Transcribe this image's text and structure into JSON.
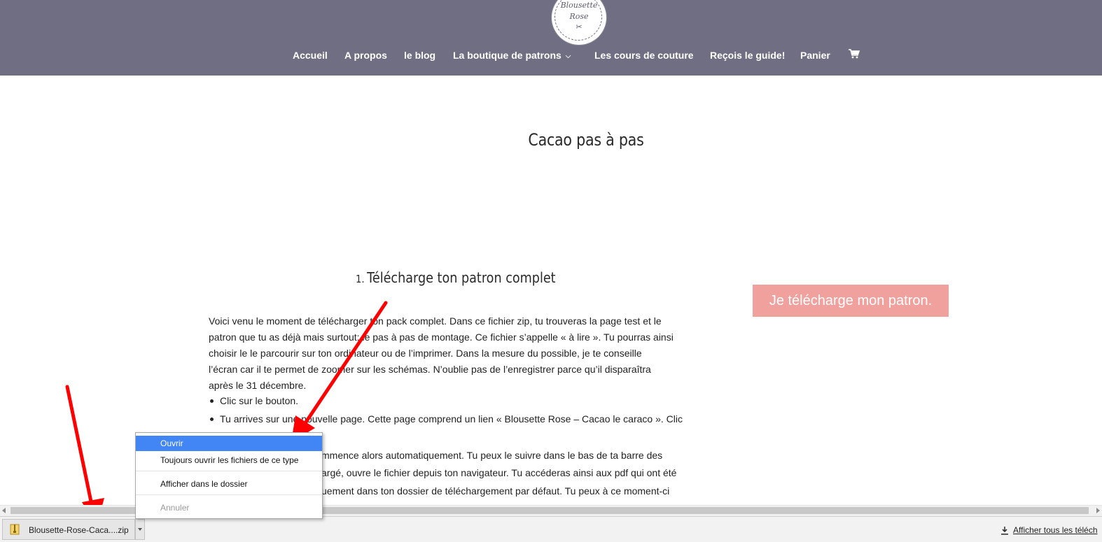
{
  "header": {
    "logo": {
      "line1": "Blousette",
      "line2": "Rose"
    },
    "nav": [
      {
        "label": "Accueil"
      },
      {
        "label": "A propos"
      },
      {
        "label": "le blog"
      },
      {
        "label": "La boutique de patrons",
        "has_dropdown": true
      },
      {
        "label": "Les cours de couture"
      },
      {
        "label": "Reçois le guide!"
      },
      {
        "label": "Panier"
      }
    ],
    "cart_icon": "cart-icon",
    "background": "#6f6e82"
  },
  "main": {
    "title": "Cacao pas à pas",
    "step": {
      "number": "1.",
      "heading": "Télécharge ton patron complet"
    },
    "paragraph_lines": [
      "Voici venu le moment de télécharger ton pack complet. Dans ce fichier zip, tu trouveras la page test et le",
      "patron que tu as déjà mais surtout: le pas à pas de montage. Ce fichier s’appelle « à lire ». Tu pourras ainsi",
      "choisir le le parcourir sur ton ordinateur ou de l’imprimer. Dans la mesure du possible, je te conseille",
      "l’écran car il te permet de zoomer sur les schémas. N’oublie pas de l’enregistrer parce qu’il disparaîtra",
      "après le 31 décembre."
    ],
    "bullets": [
      "Clic sur le bouton.",
      "Tu arrives sur une nouvelle page. Cette page comprend un lien « Blousette Rose – Cacao le caraco ». Clic"
    ],
    "continued_lines": [
      "mmence alors automatiquement. Tu peux le suivre dans le bas de ta barre des",
      "argé, ouvre le fichier depuis ton navigateur. Tu accéderas ainsi aux pdf qui ont été",
      "uement dans ton dossier de téléchargement par défaut. Tu peux à ce moment-ci"
    ],
    "cta_label": "Je télécharge mon patron.",
    "cta_color": "#f0a09d"
  },
  "context_menu": {
    "items": [
      {
        "label": "Ouvrir",
        "highlighted": true
      },
      {
        "label": "Toujours ouvrir les fichiers de ce type"
      },
      {
        "label": "Afficher dans le dossier"
      },
      {
        "label": "Annuler",
        "disabled": true
      }
    ],
    "highlight_color": "#4285f4"
  },
  "download_bar": {
    "file_name": "Blousette-Rose-Caca....zip",
    "file_icon": "zip-file-icon",
    "show_all_label": "Afficher tous les téléch",
    "show_all_icon": "download-icon"
  },
  "annotation_color": "#ff0000"
}
